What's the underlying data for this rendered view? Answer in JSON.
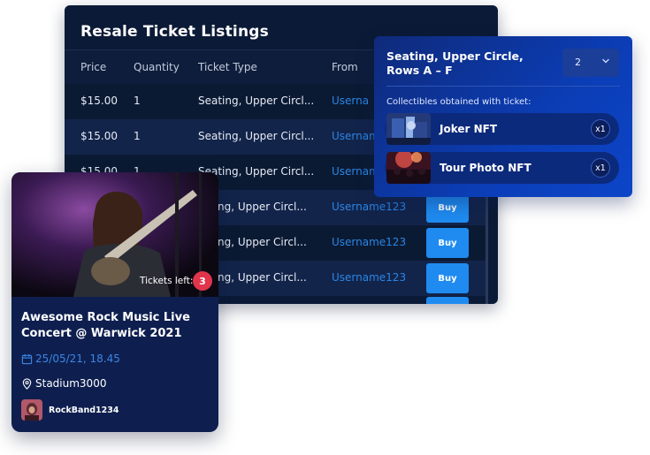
{
  "resale": {
    "title": "Resale Ticket Listings",
    "columns": [
      "Price",
      "Quantity",
      "Ticket Type",
      "From"
    ],
    "rows": [
      {
        "price": "$15.00",
        "quantity": "1",
        "type": "Seating, Upper Circl...",
        "from": "Userna"
      },
      {
        "price": "$15.00",
        "quantity": "1",
        "type": "Seating, Upper Circl...",
        "from": "Usernam"
      },
      {
        "price": "$15.00",
        "quantity": "1",
        "type": "Seating, Upper Circl...",
        "from": "Usernam"
      },
      {
        "price": "",
        "quantity": "",
        "type": "ting, Upper Circl...",
        "from": "Username123",
        "buy": "Buy"
      },
      {
        "price": "",
        "quantity": "",
        "type": "ting, Upper Circl...",
        "from": "Username123",
        "buy": "Buy"
      },
      {
        "price": "",
        "quantity": "",
        "type": "ting, Upper Circl...",
        "from": "Username123",
        "buy": "Buy"
      }
    ]
  },
  "popup": {
    "seat_line1": "Seating, Upper Circle,",
    "seat_line2": "Rows A – F",
    "qty_value": "2",
    "collectibles_title": "Collectibles obtained with ticket:",
    "collectibles": [
      {
        "name": "Joker NFT",
        "count": "x1"
      },
      {
        "name": "Tour Photo NFT",
        "count": "x1"
      }
    ]
  },
  "card": {
    "tickets_left_label": "Tickets left:",
    "tickets_left_count": "3",
    "title_line1": "Awesome Rock Music Live",
    "title_line2": "Concert @ Warwick 2021",
    "date": "25/05/21,  18.45",
    "venue": "Stadium3000",
    "artist": "RockBand1234"
  },
  "colors": {
    "panel_bg": "#0b1a36",
    "popup_bg": "#0b3db5",
    "accent_blue": "#1f8bf0",
    "link_blue": "#2a86e6",
    "badge_red": "#e0354b"
  }
}
